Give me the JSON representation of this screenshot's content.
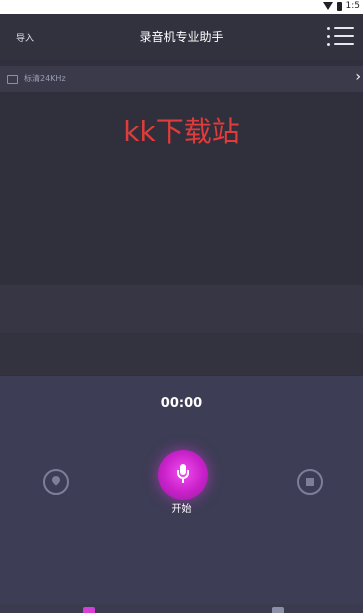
{
  "status_bar": {
    "time": "1:5"
  },
  "header": {
    "import_label": "导入",
    "title": "录音机专业助手"
  },
  "sample_bar": {
    "label": "标清24KHz",
    "chevron": "›"
  },
  "watermark": "kk下载站",
  "recorder": {
    "timer": "00:00",
    "record_label": "开始"
  },
  "colors": {
    "accent": "#d63fd6",
    "background": "#2f2f3d",
    "panel": "#3d3d55"
  }
}
